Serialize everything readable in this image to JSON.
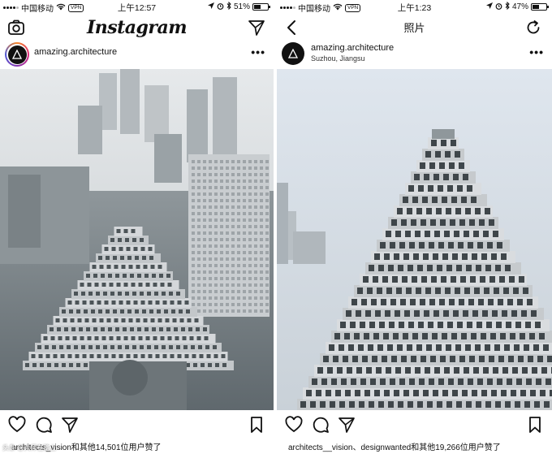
{
  "left": {
    "status": {
      "carrier": "中国移动",
      "vpn": "VPN",
      "time": "上午12:57",
      "battery": "51%",
      "battery_level": 0.51
    },
    "nav": {
      "logo": "Instagram"
    },
    "post": {
      "username": "amazing.architecture",
      "more": "•••",
      "likes": "architects_vision和其他14,501位用户赞了"
    },
    "icons": {
      "camera": "camera-icon",
      "direct": "direct-message-icon",
      "heart": "heart-icon",
      "comment": "comment-icon",
      "share": "share-icon",
      "bookmark": "bookmark-icon"
    }
  },
  "right": {
    "status": {
      "carrier": "中国移动",
      "vpn": "VPN",
      "time": "上午1:23",
      "battery": "47%",
      "battery_level": 0.47
    },
    "nav": {
      "title": "照片"
    },
    "post": {
      "username": "amazing.architecture",
      "location": "Suzhou, Jiangsu",
      "more": "•••",
      "likes": "architects__vision、designwanted和其他19,266位用户赞了"
    },
    "icons": {
      "back": "back-arrow-icon",
      "refresh": "refresh-icon",
      "heart": "heart-icon",
      "comment": "comment-icon",
      "share": "share-icon",
      "bookmark": "bookmark-icon"
    }
  },
  "watermark": "头条 @大师在路上",
  "colors": {
    "text": "#111111",
    "sky_left": "#d9dde0",
    "sky_right": "#d6dee6",
    "building": "#c9ccd0"
  }
}
